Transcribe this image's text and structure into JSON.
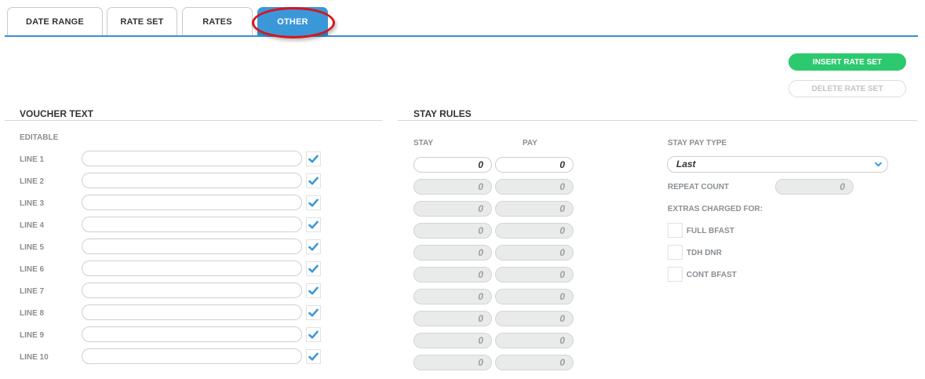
{
  "tabs": [
    {
      "label": "DATE RANGE",
      "active": false
    },
    {
      "label": "RATE SET",
      "active": false
    },
    {
      "label": "RATES",
      "active": false
    },
    {
      "label": "OTHER",
      "active": true
    }
  ],
  "actions": {
    "insert_label": "INSERT RATE SET",
    "delete_label": "DELETE RATE SET"
  },
  "voucher": {
    "title": "VOUCHER TEXT",
    "editable_label": "EDITABLE",
    "lines": [
      {
        "label": "LINE 1",
        "value": "",
        "editable": true
      },
      {
        "label": "LINE 2",
        "value": "",
        "editable": true
      },
      {
        "label": "LINE 3",
        "value": "",
        "editable": true
      },
      {
        "label": "LINE 4",
        "value": "",
        "editable": true
      },
      {
        "label": "LINE 5",
        "value": "",
        "editable": true
      },
      {
        "label": "LINE 6",
        "value": "",
        "editable": true
      },
      {
        "label": "LINE 7",
        "value": "",
        "editable": true
      },
      {
        "label": "LINE 8",
        "value": "",
        "editable": true
      },
      {
        "label": "LINE 9",
        "value": "",
        "editable": true
      },
      {
        "label": "LINE 10",
        "value": "",
        "editable": true
      }
    ]
  },
  "stay_rules": {
    "title": "STAY RULES",
    "stay_header": "STAY",
    "pay_header": "PAY",
    "rows": [
      {
        "stay": "0",
        "pay": "0",
        "enabled": true
      },
      {
        "stay": "0",
        "pay": "0",
        "enabled": false
      },
      {
        "stay": "0",
        "pay": "0",
        "enabled": false
      },
      {
        "stay": "0",
        "pay": "0",
        "enabled": false
      },
      {
        "stay": "0",
        "pay": "0",
        "enabled": false
      },
      {
        "stay": "0",
        "pay": "0",
        "enabled": false
      },
      {
        "stay": "0",
        "pay": "0",
        "enabled": false
      },
      {
        "stay": "0",
        "pay": "0",
        "enabled": false
      },
      {
        "stay": "0",
        "pay": "0",
        "enabled": false
      },
      {
        "stay": "0",
        "pay": "0",
        "enabled": false
      }
    ],
    "pay_type_label": "STAY PAY TYPE",
    "pay_type_value": "Last",
    "repeat_count_label": "REPEAT COUNT",
    "repeat_count_value": "0",
    "extras_label": "EXTRAS CHARGED FOR:",
    "extras": [
      {
        "label": "FULL BFAST",
        "checked": false
      },
      {
        "label": "TDH DNR",
        "checked": false
      },
      {
        "label": "CONT BFAST",
        "checked": false
      }
    ]
  },
  "colors": {
    "accent": "#3a97d8",
    "insert_button": "#2dc96f",
    "highlight": "#d8141d"
  }
}
